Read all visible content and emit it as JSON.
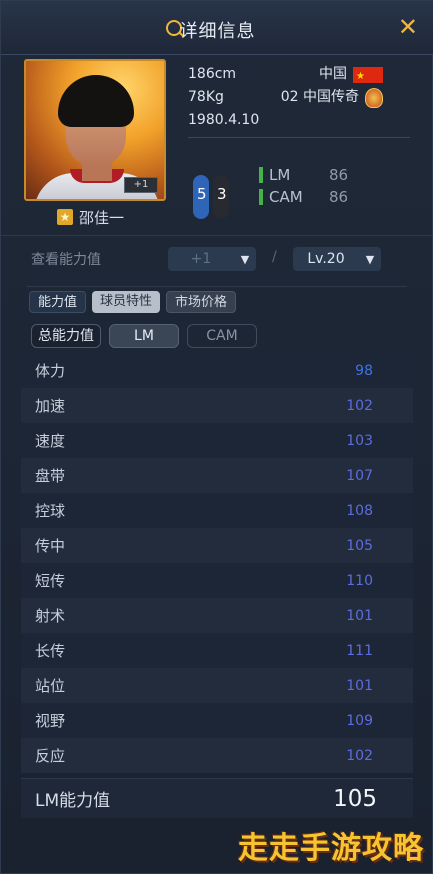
{
  "header": {
    "title": "详细信息",
    "close_label": "✕"
  },
  "player": {
    "name": "邵佳一",
    "card_boost": "+1",
    "height": "186cm",
    "weight": "78Kg",
    "birthdate": "1980.4.10",
    "nation": "中国",
    "season": "02 中国传奇",
    "weak_foot_left": "5",
    "weak_foot_right": "3",
    "positions": [
      {
        "pos": "LM",
        "rating": "86"
      },
      {
        "pos": "CAM",
        "rating": "86"
      }
    ]
  },
  "controls": {
    "ability_label": "查看能力值",
    "plus_select": "+1",
    "level_select": "Lv.20",
    "separator": "/"
  },
  "tabs": [
    "能力值",
    "球员特性",
    "市场价格"
  ],
  "subtabs": [
    "总能力值",
    "LM",
    "CAM"
  ],
  "stats": [
    {
      "name": "体力",
      "value": "98"
    },
    {
      "name": "加速",
      "value": "102"
    },
    {
      "name": "速度",
      "value": "103"
    },
    {
      "name": "盘带",
      "value": "107"
    },
    {
      "name": "控球",
      "value": "108"
    },
    {
      "name": "传中",
      "value": "105"
    },
    {
      "name": "短传",
      "value": "110"
    },
    {
      "name": "射术",
      "value": "101"
    },
    {
      "name": "长传",
      "value": "111"
    },
    {
      "name": "站位",
      "value": "101"
    },
    {
      "name": "视野",
      "value": "109"
    },
    {
      "name": "反应",
      "value": "102"
    }
  ],
  "total": {
    "label": "LM能力值",
    "value": "105"
  },
  "watermark": "走走手游攻略"
}
